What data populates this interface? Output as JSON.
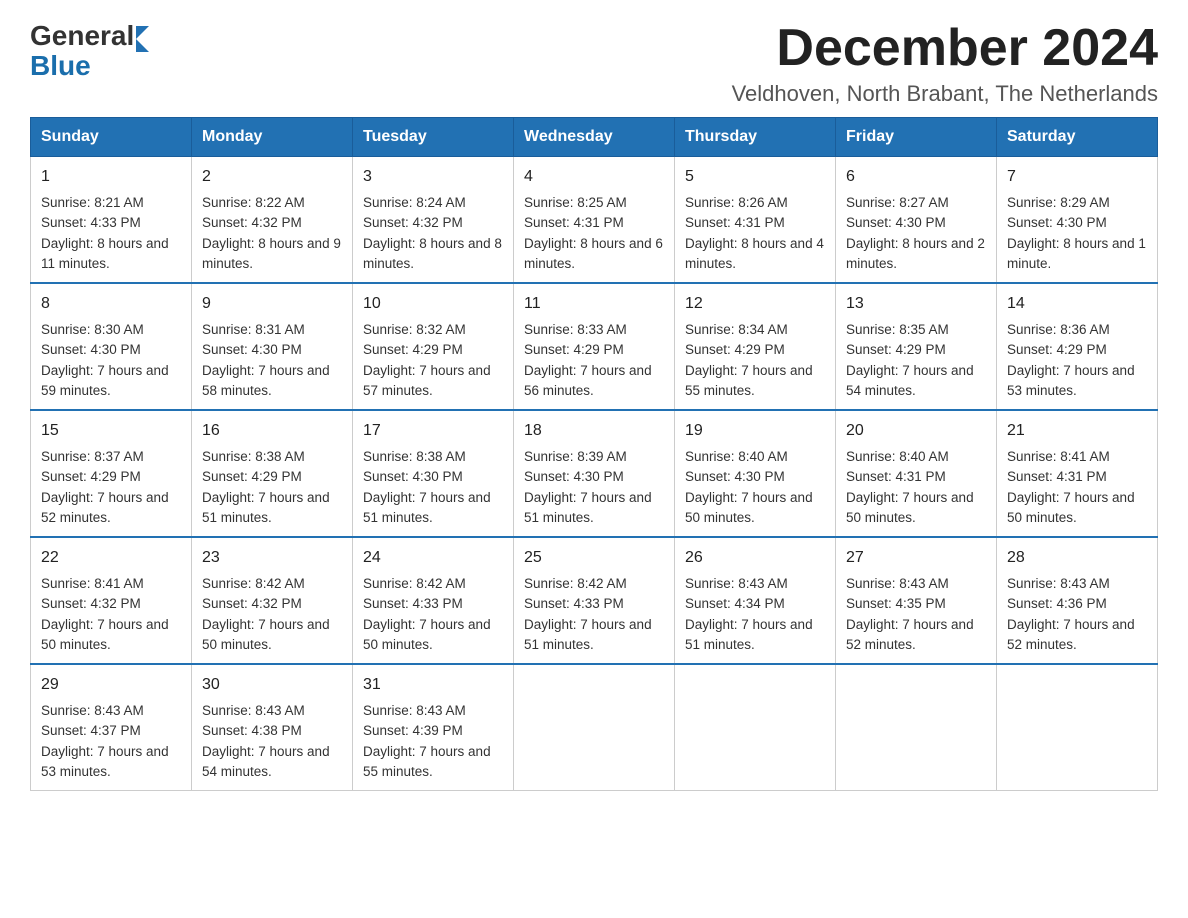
{
  "header": {
    "logo_general": "General",
    "logo_blue": "Blue",
    "month_title": "December 2024",
    "location": "Veldhoven, North Brabant, The Netherlands"
  },
  "days_of_week": [
    "Sunday",
    "Monday",
    "Tuesday",
    "Wednesday",
    "Thursday",
    "Friday",
    "Saturday"
  ],
  "weeks": [
    [
      {
        "day": "1",
        "sunrise": "8:21 AM",
        "sunset": "4:33 PM",
        "daylight": "8 hours and 11 minutes."
      },
      {
        "day": "2",
        "sunrise": "8:22 AM",
        "sunset": "4:32 PM",
        "daylight": "8 hours and 9 minutes."
      },
      {
        "day": "3",
        "sunrise": "8:24 AM",
        "sunset": "4:32 PM",
        "daylight": "8 hours and 8 minutes."
      },
      {
        "day": "4",
        "sunrise": "8:25 AM",
        "sunset": "4:31 PM",
        "daylight": "8 hours and 6 minutes."
      },
      {
        "day": "5",
        "sunrise": "8:26 AM",
        "sunset": "4:31 PM",
        "daylight": "8 hours and 4 minutes."
      },
      {
        "day": "6",
        "sunrise": "8:27 AM",
        "sunset": "4:30 PM",
        "daylight": "8 hours and 2 minutes."
      },
      {
        "day": "7",
        "sunrise": "8:29 AM",
        "sunset": "4:30 PM",
        "daylight": "8 hours and 1 minute."
      }
    ],
    [
      {
        "day": "8",
        "sunrise": "8:30 AM",
        "sunset": "4:30 PM",
        "daylight": "7 hours and 59 minutes."
      },
      {
        "day": "9",
        "sunrise": "8:31 AM",
        "sunset": "4:30 PM",
        "daylight": "7 hours and 58 minutes."
      },
      {
        "day": "10",
        "sunrise": "8:32 AM",
        "sunset": "4:29 PM",
        "daylight": "7 hours and 57 minutes."
      },
      {
        "day": "11",
        "sunrise": "8:33 AM",
        "sunset": "4:29 PM",
        "daylight": "7 hours and 56 minutes."
      },
      {
        "day": "12",
        "sunrise": "8:34 AM",
        "sunset": "4:29 PM",
        "daylight": "7 hours and 55 minutes."
      },
      {
        "day": "13",
        "sunrise": "8:35 AM",
        "sunset": "4:29 PM",
        "daylight": "7 hours and 54 minutes."
      },
      {
        "day": "14",
        "sunrise": "8:36 AM",
        "sunset": "4:29 PM",
        "daylight": "7 hours and 53 minutes."
      }
    ],
    [
      {
        "day": "15",
        "sunrise": "8:37 AM",
        "sunset": "4:29 PM",
        "daylight": "7 hours and 52 minutes."
      },
      {
        "day": "16",
        "sunrise": "8:38 AM",
        "sunset": "4:29 PM",
        "daylight": "7 hours and 51 minutes."
      },
      {
        "day": "17",
        "sunrise": "8:38 AM",
        "sunset": "4:30 PM",
        "daylight": "7 hours and 51 minutes."
      },
      {
        "day": "18",
        "sunrise": "8:39 AM",
        "sunset": "4:30 PM",
        "daylight": "7 hours and 51 minutes."
      },
      {
        "day": "19",
        "sunrise": "8:40 AM",
        "sunset": "4:30 PM",
        "daylight": "7 hours and 50 minutes."
      },
      {
        "day": "20",
        "sunrise": "8:40 AM",
        "sunset": "4:31 PM",
        "daylight": "7 hours and 50 minutes."
      },
      {
        "day": "21",
        "sunrise": "8:41 AM",
        "sunset": "4:31 PM",
        "daylight": "7 hours and 50 minutes."
      }
    ],
    [
      {
        "day": "22",
        "sunrise": "8:41 AM",
        "sunset": "4:32 PM",
        "daylight": "7 hours and 50 minutes."
      },
      {
        "day": "23",
        "sunrise": "8:42 AM",
        "sunset": "4:32 PM",
        "daylight": "7 hours and 50 minutes."
      },
      {
        "day": "24",
        "sunrise": "8:42 AM",
        "sunset": "4:33 PM",
        "daylight": "7 hours and 50 minutes."
      },
      {
        "day": "25",
        "sunrise": "8:42 AM",
        "sunset": "4:33 PM",
        "daylight": "7 hours and 51 minutes."
      },
      {
        "day": "26",
        "sunrise": "8:43 AM",
        "sunset": "4:34 PM",
        "daylight": "7 hours and 51 minutes."
      },
      {
        "day": "27",
        "sunrise": "8:43 AM",
        "sunset": "4:35 PM",
        "daylight": "7 hours and 52 minutes."
      },
      {
        "day": "28",
        "sunrise": "8:43 AM",
        "sunset": "4:36 PM",
        "daylight": "7 hours and 52 minutes."
      }
    ],
    [
      {
        "day": "29",
        "sunrise": "8:43 AM",
        "sunset": "4:37 PM",
        "daylight": "7 hours and 53 minutes."
      },
      {
        "day": "30",
        "sunrise": "8:43 AM",
        "sunset": "4:38 PM",
        "daylight": "7 hours and 54 minutes."
      },
      {
        "day": "31",
        "sunrise": "8:43 AM",
        "sunset": "4:39 PM",
        "daylight": "7 hours and 55 minutes."
      },
      null,
      null,
      null,
      null
    ]
  ],
  "labels": {
    "sunrise": "Sunrise:",
    "sunset": "Sunset:",
    "daylight": "Daylight:"
  }
}
